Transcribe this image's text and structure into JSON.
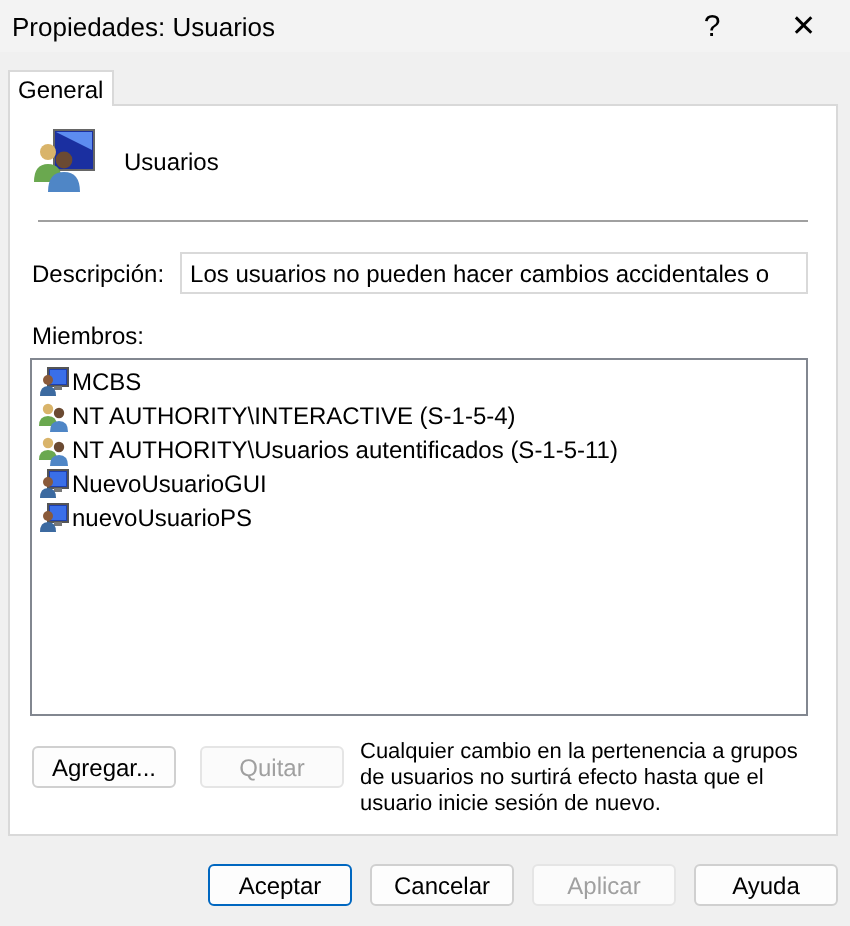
{
  "window": {
    "title": "Propiedades: Usuarios",
    "help": "?",
    "close": "✕"
  },
  "tabs": [
    {
      "label": "General",
      "selected": true
    }
  ],
  "group": {
    "name": "Usuarios"
  },
  "description": {
    "label": "Descripción:",
    "value": "Los usuarios no pueden hacer cambios accidentales o"
  },
  "members": {
    "label": "Miembros:",
    "items": [
      {
        "name": "MCBS",
        "kind": "user",
        "selected": false
      },
      {
        "name": "NT AUTHORITY\\INTERACTIVE (S-1-5-4)",
        "kind": "group",
        "selected": false
      },
      {
        "name": "NT AUTHORITY\\Usuarios autentificados (S-1-5-11)",
        "kind": "group",
        "selected": false
      },
      {
        "name": "NuevoUsuarioGUI",
        "kind": "user",
        "selected": false
      },
      {
        "name": "nuevoUsuarioPS",
        "kind": "user",
        "selected": false
      }
    ]
  },
  "member_buttons": [
    {
      "label": "Agregar...",
      "disabled": false
    },
    {
      "label": "Quitar",
      "disabled": true
    }
  ],
  "note": "Cualquier cambio en la pertenencia a grupos de usuarios no surtirá efecto hasta que el usuario inicie sesión de nuevo.",
  "buttons": [
    {
      "label": "Aceptar",
      "disabled": false,
      "default": true
    },
    {
      "label": "Cancelar",
      "disabled": false,
      "default": false
    },
    {
      "label": "Aplicar",
      "disabled": true,
      "default": false
    },
    {
      "label": "Ayuda",
      "disabled": false,
      "default": false
    }
  ]
}
